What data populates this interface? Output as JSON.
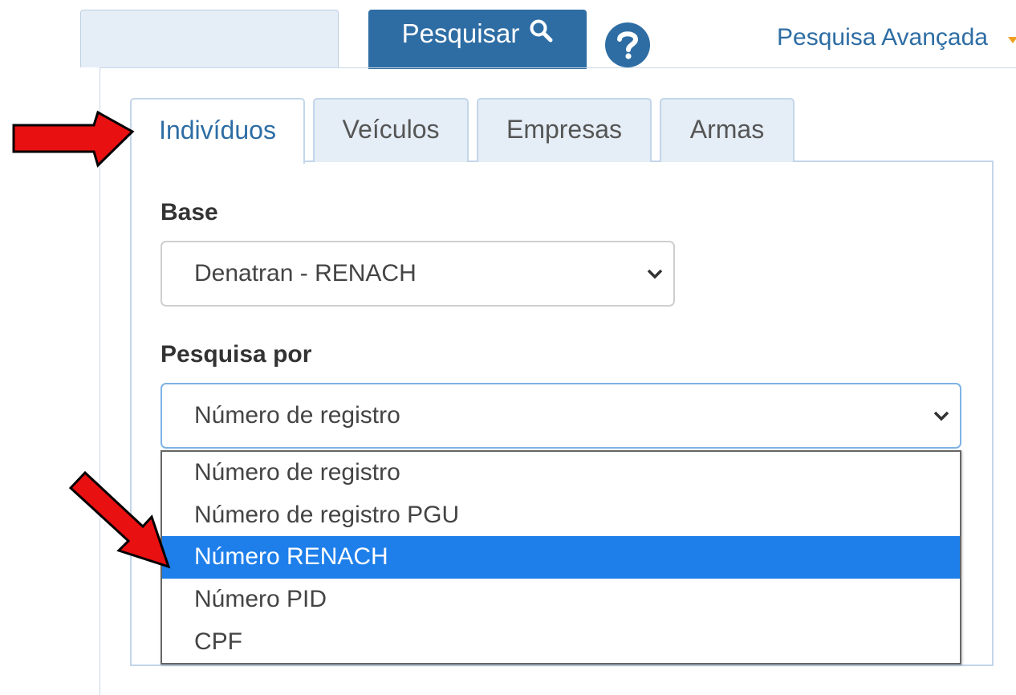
{
  "header": {
    "search_button_label": "Pesquisar",
    "advanced_search_label": "Pesquisa Avançada"
  },
  "tabs": [
    {
      "label": "Indivíduos",
      "active": true
    },
    {
      "label": "Veículos",
      "active": false
    },
    {
      "label": "Empresas",
      "active": false
    },
    {
      "label": "Armas",
      "active": false
    }
  ],
  "form": {
    "base_label": "Base",
    "base_value": "Denatran - RENACH",
    "pesquisa_label": "Pesquisa por",
    "pesquisa_value": "Número de registro"
  },
  "dropdown": {
    "options": [
      "Número de registro",
      "Número de registro PGU",
      "Número RENACH",
      "Número PID",
      "CPF"
    ],
    "highlighted_option": "Número RENACH"
  },
  "colors": {
    "primary": "#2e6da4",
    "highlight": "#1e7fea",
    "arrow": "#e81010",
    "caret": "#f0a020"
  }
}
